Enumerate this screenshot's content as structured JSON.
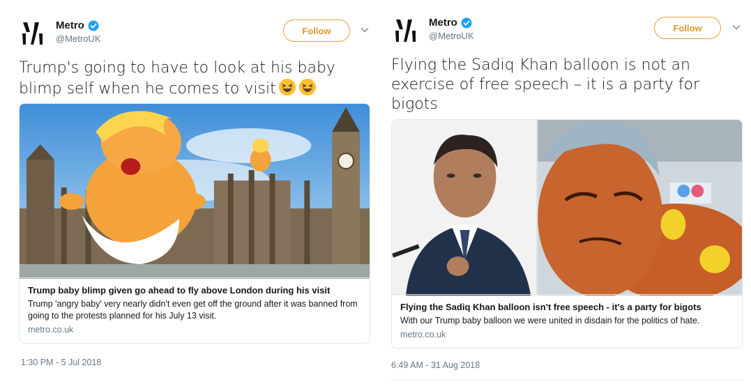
{
  "colors": {
    "accent": "#1da1f2",
    "follow": "#e09a2a",
    "secondary_text": "#657786",
    "border": "#e1e8ed"
  },
  "tweets": [
    {
      "author": {
        "name": "Metro",
        "handle": "@MetroUK",
        "verified_icon": "verified-badge-icon",
        "avatar_icon": "metro-logo-icon"
      },
      "follow_label": "Follow",
      "text": "Trump's going to have to look at his baby blimp self when he comes to visit",
      "emojis": [
        "laughing-face-icon",
        "laughing-face-icon"
      ],
      "card": {
        "image_description_icon": "trump-baby-blimp-parliament-image",
        "title": "Trump baby blimp given go ahead to fly above London during his visit",
        "description": "Trump 'angry baby' very nearly didn't even get off the ground after it was banned from going to the protests planned for his July 13 visit.",
        "domain": "metro.co.uk"
      },
      "timestamp": "1:30 PM - 5 Jul 2018"
    },
    {
      "author": {
        "name": "Metro",
        "handle": "@MetroUK",
        "verified_icon": "verified-badge-icon",
        "avatar_icon": "metro-logo-icon"
      },
      "follow_label": "Follow",
      "text": "Flying the Sadiq Khan balloon is not an exercise of free speech – it is a party for bigots",
      "card": {
        "image_description_icon": "sadiq-khan-balloon-image",
        "title": "Flying the Sadiq Khan balloon isn't free speech - it's a party for bigots",
        "description": "With our Trump baby balloon we were united in disdain for the politics of hate.",
        "domain": "metro.co.uk"
      },
      "timestamp": "6:49 AM - 31 Aug 2018"
    }
  ]
}
